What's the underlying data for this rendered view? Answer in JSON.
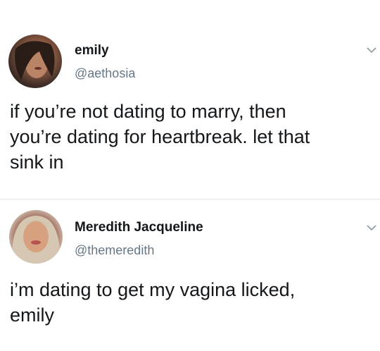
{
  "tweets": [
    {
      "display_name": "emily",
      "handle": "@aethosia",
      "text": "if you’re not dating to marry, then\nyou’re dating for heartbreak. let that\nsink in",
      "avatar_icon": "profile-photo",
      "menu_icon": "chevron-down-icon"
    },
    {
      "display_name": "Meredith Jacqueline",
      "handle": "@themeredith",
      "text": "i’m dating to get my vagina licked,\nemily",
      "avatar_icon": "profile-photo",
      "menu_icon": "chevron-down-icon"
    }
  ],
  "colors": {
    "text": "#14171a",
    "handle": "#657786",
    "divider": "#e1e8ed",
    "chevron": "#8899a6"
  }
}
